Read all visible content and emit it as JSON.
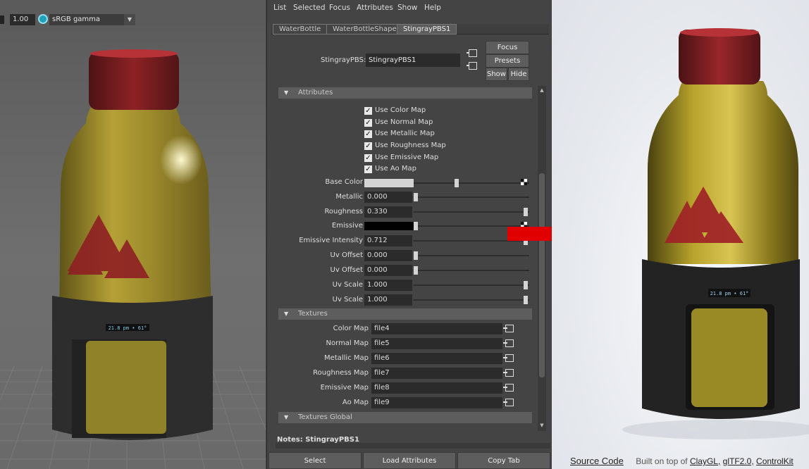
{
  "viewport": {
    "exposure_value": "1.00",
    "color_space": "sRGB gamma",
    "bottle_display_text": "21.8 pm • 61°"
  },
  "menu": [
    "List",
    "Selected",
    "Focus",
    "Attributes",
    "Show",
    "Help"
  ],
  "tabs": [
    {
      "label": "WaterBottle",
      "active": false
    },
    {
      "label": "WaterBottleShape",
      "active": false
    },
    {
      "label": "StingrayPBS1",
      "active": true
    }
  ],
  "node": {
    "label": "StingrayPBS:",
    "name": "StingrayPBS1"
  },
  "buttons": {
    "focus": "Focus",
    "presets": "Presets",
    "show": "Show",
    "hide": "Hide"
  },
  "sections": {
    "attributes": "Attributes",
    "textures": "Textures",
    "textures_global": "Textures Global"
  },
  "checkboxes": [
    {
      "label": "Use Color Map",
      "checked": true
    },
    {
      "label": "Use Normal Map",
      "checked": true
    },
    {
      "label": "Use Metallic Map",
      "checked": true
    },
    {
      "label": "Use Roughness Map",
      "checked": true
    },
    {
      "label": "Use Emissive Map",
      "checked": true
    },
    {
      "label": "Use Ao Map",
      "checked": true
    }
  ],
  "attributes": [
    {
      "label": "Base Color",
      "kind": "color",
      "color": "#d4d4d4",
      "slider": 0.5
    },
    {
      "label": "Metallic",
      "kind": "number",
      "value": "0.000",
      "slider": 0.0
    },
    {
      "label": "Roughness",
      "kind": "number",
      "value": "0.330",
      "slider": 1.0
    },
    {
      "label": "Emissive",
      "kind": "color",
      "color": "#000000",
      "slider": 0.0
    },
    {
      "label": "Emissive Intensity",
      "kind": "number",
      "value": "0.712",
      "slider": 1.0
    },
    {
      "label": "Uv Offset",
      "kind": "number",
      "value": "0.000",
      "slider": 0.0
    },
    {
      "label": "Uv Offset",
      "kind": "number",
      "value": "0.000",
      "slider": 0.0
    },
    {
      "label": "Uv Scale",
      "kind": "number",
      "value": "1.000",
      "slider": 1.0
    },
    {
      "label": "Uv Scale",
      "kind": "number",
      "value": "1.000",
      "slider": 1.0
    }
  ],
  "textures": [
    {
      "label": "Color Map",
      "file": "file4"
    },
    {
      "label": "Normal Map",
      "file": "file5"
    },
    {
      "label": "Metallic Map",
      "file": "file6"
    },
    {
      "label": "Roughness Map",
      "file": "file7"
    },
    {
      "label": "Emissive Map",
      "file": "file8"
    },
    {
      "label": "Ao Map",
      "file": "file9"
    }
  ],
  "notes": "Notes:  StingrayPBS1",
  "bottom_buttons": {
    "select": "Select",
    "load": "Load Attributes",
    "copy": "Copy Tab"
  },
  "preview": {
    "bottle_display_text": "21.8 pm • 61°",
    "footer": {
      "source": "Source Code",
      "built": "Built on top of",
      "claygl": "ClayGL,",
      "gltf": "glTF2.0,",
      "controlkit": "ControlKit"
    }
  },
  "colors": {
    "accent_arrow": "#e10000",
    "bottle_gold": "#b8a33a",
    "cap_red": "#8a1f22",
    "sleeve": "#2a2a2a"
  }
}
